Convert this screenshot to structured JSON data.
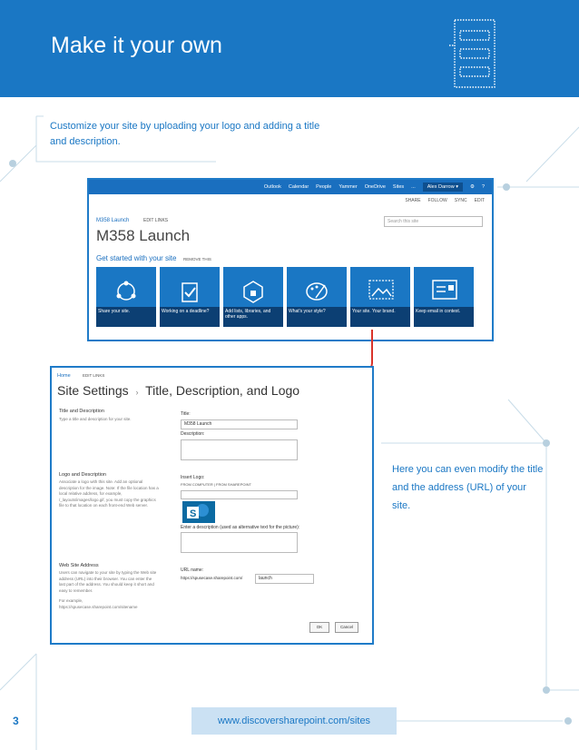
{
  "header": {
    "title": "Make it your own"
  },
  "intro": {
    "text": "Customize your site by uploading your logo and adding a title and description."
  },
  "side_note": {
    "text": "Here you can even modify the title and the address (URL) of your site."
  },
  "sp_home": {
    "nav": [
      "Outlook",
      "Calendar",
      "People",
      "Yammer",
      "OneDrive",
      "Sites",
      "...",
      "Alex Darrow ▾",
      "⚙",
      "?"
    ],
    "actions": [
      "SHARE",
      "FOLLOW",
      "SYNC",
      "EDIT"
    ],
    "breadcrumb": "M358 Launch",
    "edit_links": "EDIT LINKS",
    "search_placeholder": "Search this site",
    "site_title": "M358 Launch",
    "get_started": "Get started with your site",
    "remove": "REMOVE THIS",
    "tiles": [
      "Share your site.",
      "Working on a deadline?",
      "Add lists, libraries, and other apps.",
      "What's your style?",
      "Your site. Your brand.",
      "Keep email in context."
    ]
  },
  "sp_settings": {
    "home": "Home",
    "edit_links": "EDIT LINKS",
    "title_main": "Site Settings",
    "title_sep": "›",
    "title_sub": "Title, Description, and Logo",
    "sec1_heading": "Title and Description",
    "sec1_desc": "Type a title and description for your site.",
    "title_label": "Title:",
    "title_value": "M358 Launch",
    "description_label": "Description:",
    "sec2_heading": "Logo and Description",
    "sec2_desc": "Associate a logo with this site. Add an optional description for the image. Note: If the file location has a local relative address, for example, /_layouts/images/logo.gif, you must copy the graphics file to that location on each front-end Web server.",
    "insert_logo_label": "Insert Logo:",
    "from_label": "FROM COMPUTER | FROM SHAREPOINT",
    "logo_desc_label": "Enter a description (used as alternative text for the picture):",
    "sec3_heading": "Web Site Address",
    "sec3_desc": "Users can navigate to your site by typing the Web site address (URL) into their browser. You can enter the last part of the address. You should keep it short and easy to remember.",
    "sec3_example": "For example, https://spusecase.sharepoint.com/sitename",
    "url_label": "URL name:",
    "url_prefix": "https://spusecase.sharepoint.com/",
    "url_value": "launch",
    "ok": "OK",
    "cancel": "Cancel"
  },
  "footer": {
    "page_number": "3",
    "url": "www.discoversharepoint.com/sites"
  },
  "colors": {
    "brand_blue": "#1a77c4",
    "arrow_red": "#d9342b",
    "footer_bg": "#cbe1f3"
  }
}
